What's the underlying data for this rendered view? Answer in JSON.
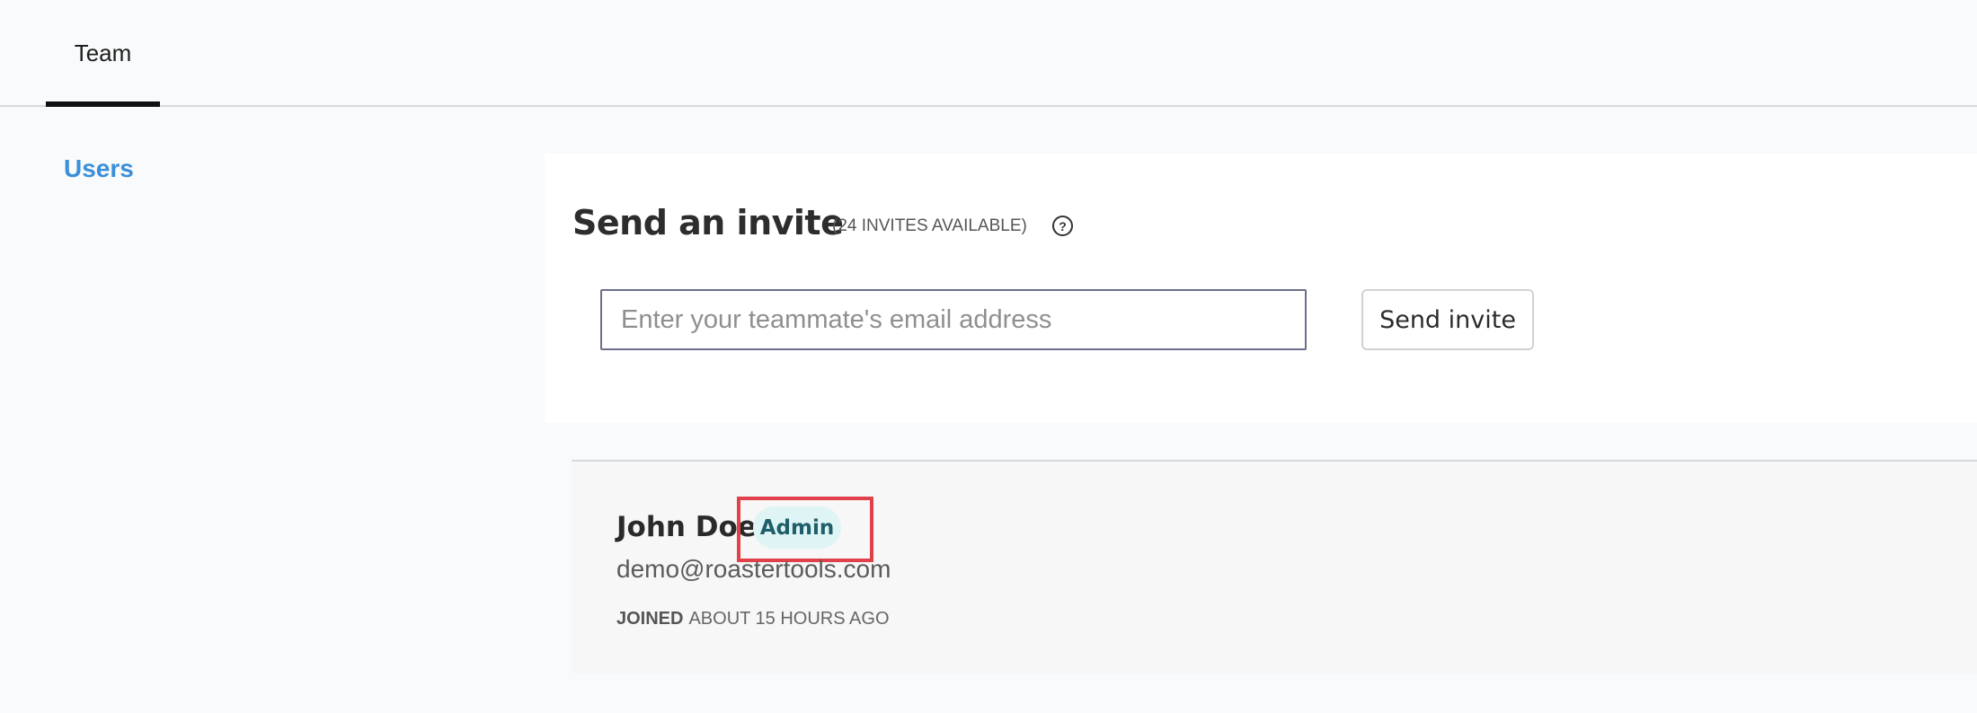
{
  "tabs": [
    {
      "label": "Team",
      "active": true
    }
  ],
  "sidebar": {
    "items": [
      {
        "label": "Users",
        "active": true
      }
    ]
  },
  "invite": {
    "title": "Send an invite",
    "available_text": "(24 INVITES AVAILABLE)",
    "help_icon": "question-circle-icon",
    "email_placeholder": "Enter your teammate's email address",
    "email_value": "",
    "send_label": "Send invite"
  },
  "users": [
    {
      "name": "John Doe",
      "role": "Admin",
      "email": "demo@roastertools.com",
      "joined_label": "JOINED",
      "joined_time": "ABOUT 15 HOURS AGO"
    }
  ],
  "colors": {
    "accent_link": "#3b8fd9",
    "badge_bg": "#dff5f5",
    "badge_text": "#1f5f6a",
    "highlight": "#e0414a"
  }
}
